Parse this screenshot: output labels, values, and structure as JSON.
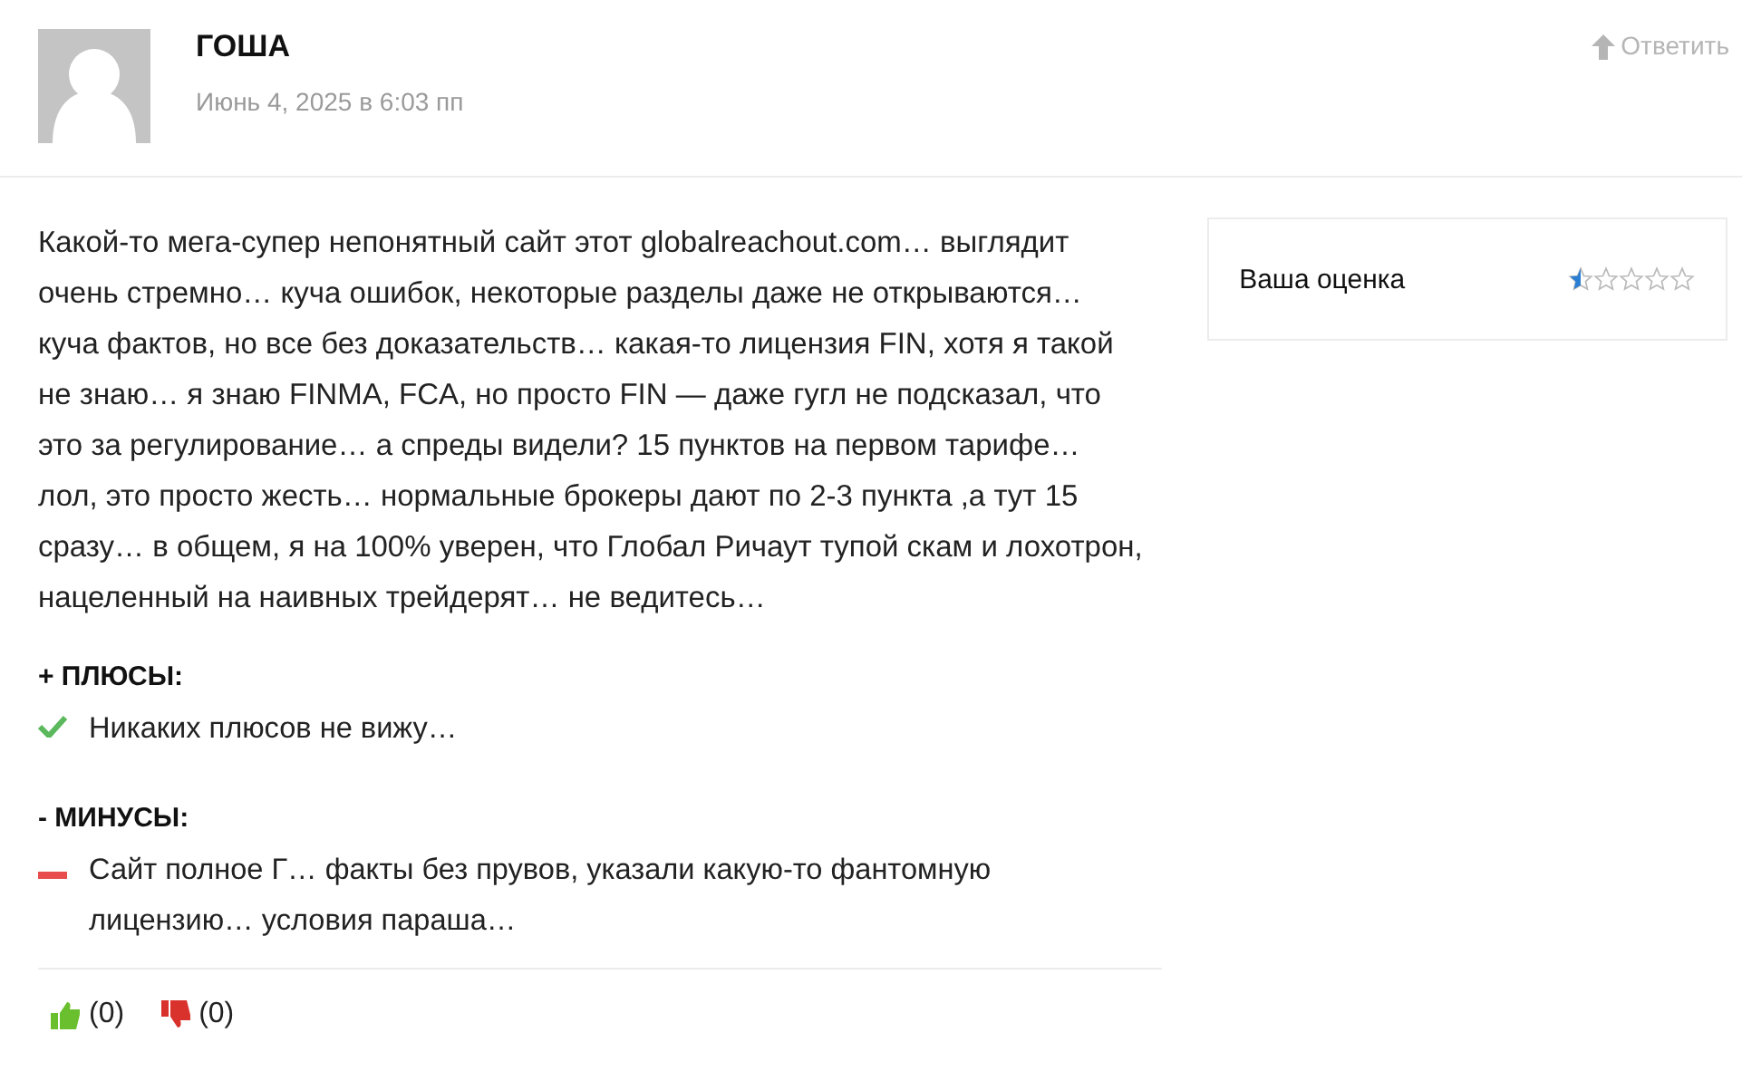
{
  "comment": {
    "author": "ГОША",
    "date": "Июнь 4, 2025 в 6:03 пп",
    "reply": "Ответить",
    "text": "Какой-то мега-супер непонятный сайт этот globalreachout.com… выглядит очень стремно… куча ошибок, некоторые разделы даже не открываются… куча фактов, но все без доказательств… какая-то лицензия FIN, хотя я такой не знаю… я знаю FINMA, FCA, но просто FIN — даже гугл не подсказал, что это за регулирование… а спреды видели? 15 пунктов на первом тарифе… лол, это просто жесть… нормальные брокеры дают по 2-3 пункта ,а тут 15 сразу… в общем, я на 100% уверен, что Глобал Ричаут тупой скам и лохотрон, нацеленный на наивных трейдерят… не ведитесь…",
    "sections": [
      {
        "kind": "pros",
        "title": "+ ПЛЮСЫ:",
        "items": [
          "Никаких плюсов не вижу…"
        ]
      },
      {
        "kind": "cons",
        "title": "- МИНУСЫ:",
        "items": [
          "Сайт полное Г… факты без прувов, указали какую-то фантомную лицензию… условия параша…"
        ]
      }
    ],
    "votes": [
      {
        "kind": "up",
        "count": "(0)"
      },
      {
        "kind": "down",
        "count": "(0)"
      }
    ]
  },
  "rating": {
    "label": "Ваша оценка",
    "stars": 0.5
  }
}
